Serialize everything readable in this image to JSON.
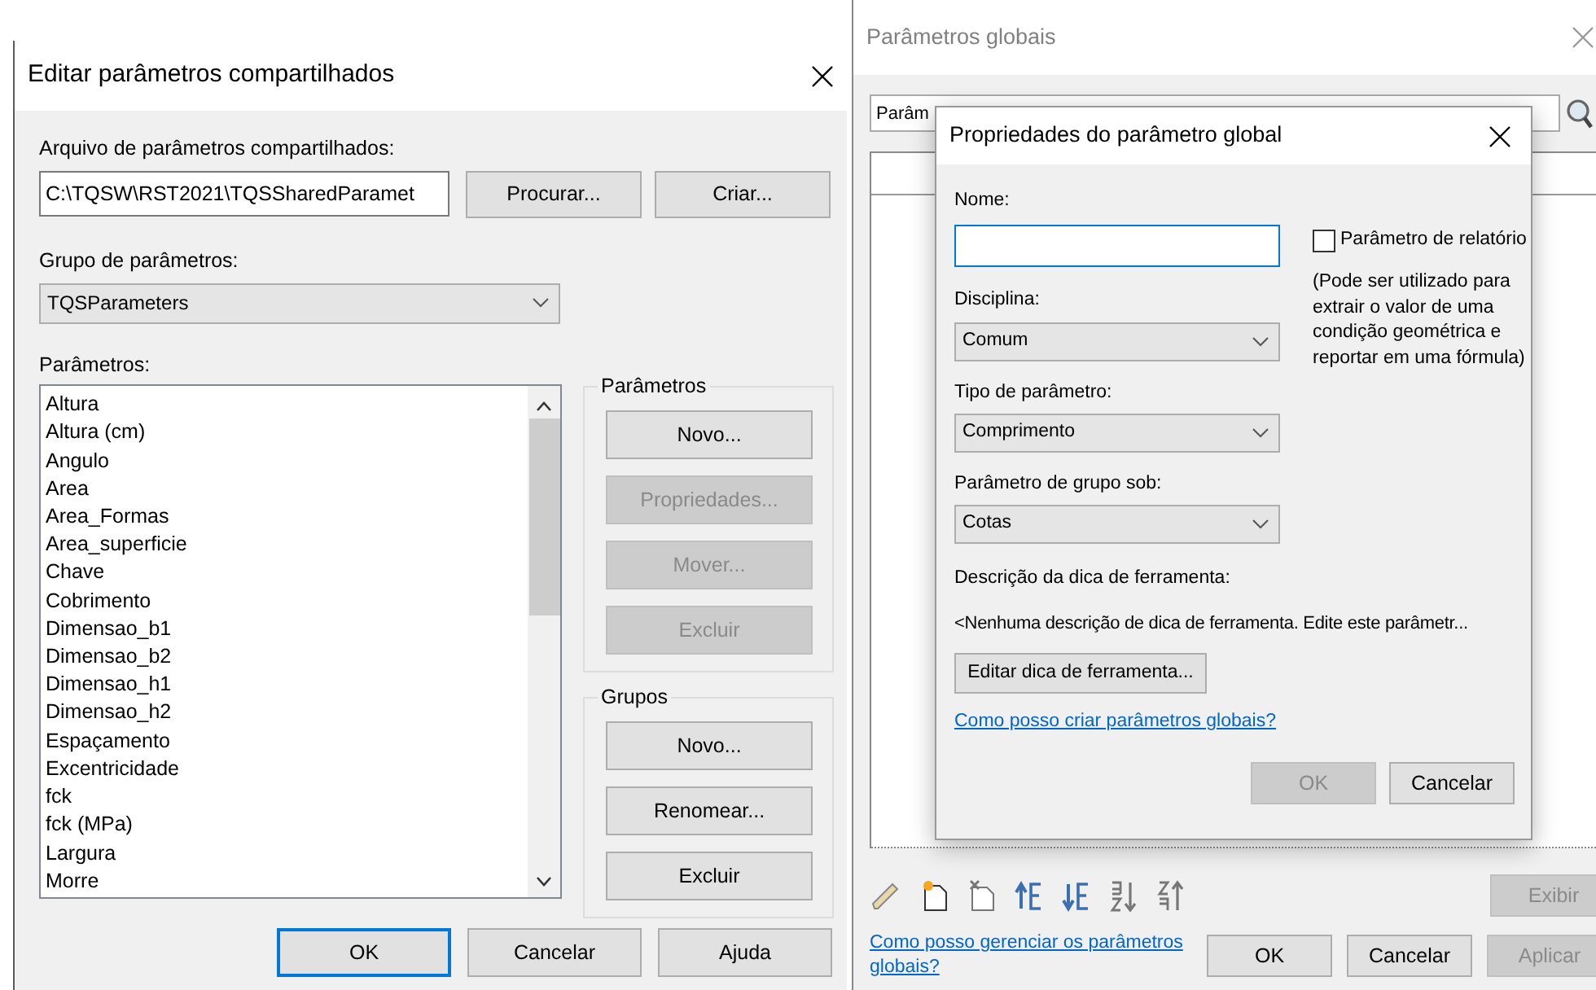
{
  "shared_dialog": {
    "title": "Editar parâmetros compartilhados",
    "file_label": "Arquivo de parâmetros compartilhados:",
    "file_path": "C:\\TQSW\\RST2021\\TQSSharedParamet",
    "file_buttons": [
      "Procurar...",
      "Criar..."
    ],
    "group_label": "Grupo de parâmetros:",
    "group_value": "TQSParameters",
    "params_label": "Parâmetros:",
    "params": [
      "Altura",
      "Altura (cm)",
      "Angulo",
      "Area",
      "Area_Formas",
      "Area_superficie",
      "Chave",
      "Cobrimento",
      "Dimensao_b1",
      "Dimensao_b2",
      "Dimensao_h1",
      "Dimensao_h2",
      "Espaçamento",
      "Excentricidade",
      "fck",
      "fck (MPa)",
      "Largura",
      "Morre"
    ],
    "boxes": [
      {
        "title": "Parâmetros",
        "buttons": [
          {
            "label": "Novo...",
            "disabled": false
          },
          {
            "label": "Propriedades...",
            "disabled": true
          },
          {
            "label": "Mover...",
            "disabled": true
          },
          {
            "label": "Excluir",
            "disabled": true
          }
        ]
      },
      {
        "title": "Grupos",
        "buttons": [
          {
            "label": "Novo...",
            "disabled": false
          },
          {
            "label": "Renomear...",
            "disabled": false
          },
          {
            "label": "Excluir",
            "disabled": false
          }
        ]
      }
    ],
    "footer_buttons": [
      {
        "label": "OK",
        "default": true
      },
      {
        "label": "Cancelar",
        "default": false
      },
      {
        "label": "Ajuda",
        "default": false
      }
    ]
  },
  "global_window": {
    "title": "Parâmetros globais",
    "search_value": "Parâm",
    "show_button": {
      "label": "Exibir",
      "disabled": true
    },
    "help_link": "Como posso gerenciar os parâmetros globais?",
    "footer_buttons": [
      {
        "label": "OK",
        "disabled": false
      },
      {
        "label": "Cancelar",
        "disabled": false
      },
      {
        "label": "Aplicar",
        "disabled": true
      }
    ]
  },
  "properties_dialog": {
    "title": "Propriedades do parâmetro global",
    "name_label": "Nome:",
    "report_checkbox": {
      "label": "Parâmetro de relatório",
      "checked": false
    },
    "report_note": "(Pode ser utilizado para extrair o valor de uma condição geométrica e reportar em uma fórmula)",
    "fields": [
      {
        "label": "Disciplina:",
        "value": "Comum"
      },
      {
        "label": "Tipo de parâmetro:",
        "value": "Comprimento"
      },
      {
        "label": "Parâmetro de grupo sob:",
        "value": "Cotas"
      }
    ],
    "tooltip_label": "Descrição da dica de ferramenta:",
    "tooltip_text": "<Nenhuma descrição de dica de ferramenta. Edite este parâmetr...",
    "edit_tooltip_button": "Editar dica de ferramenta...",
    "help_link": "Como posso criar parâmetros globais?",
    "buttons": [
      {
        "label": "OK",
        "disabled": true
      },
      {
        "label": "Cancelar",
        "disabled": false
      }
    ]
  }
}
